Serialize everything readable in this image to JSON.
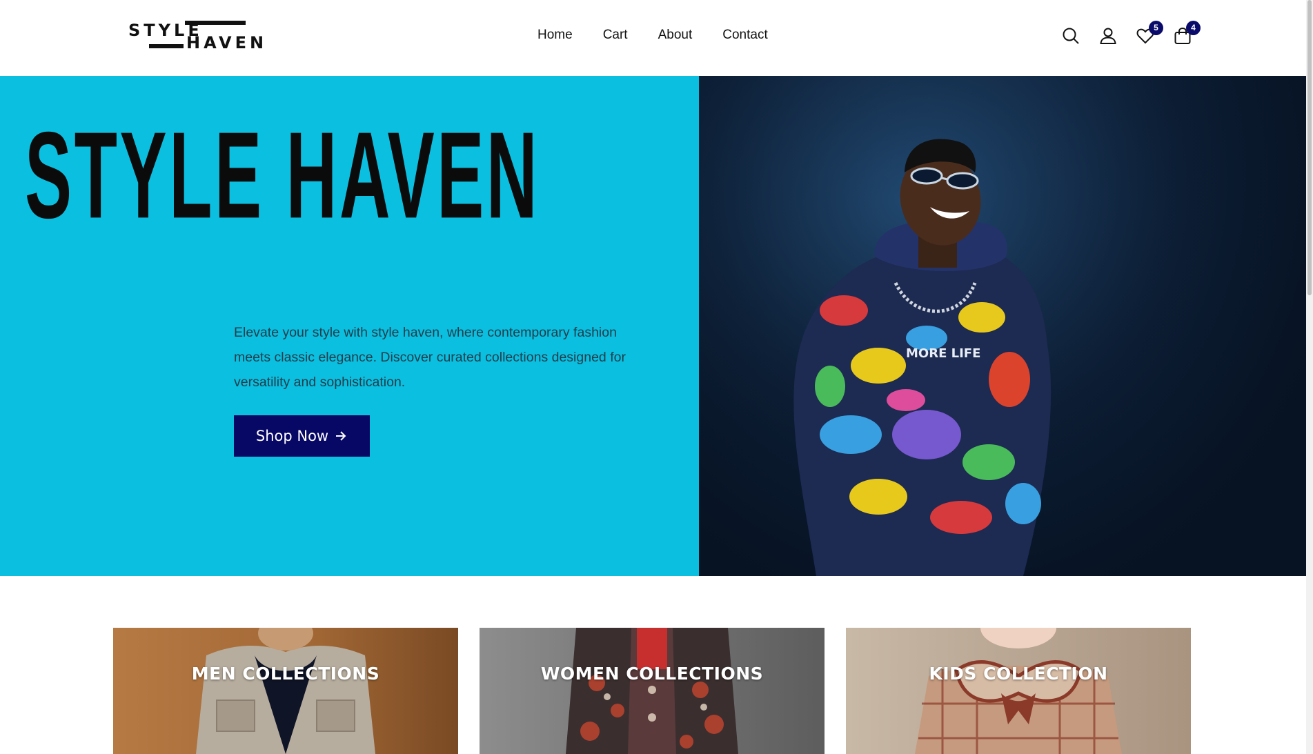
{
  "header": {
    "logo": {
      "word1": "STYLE",
      "word2": "HAVEN"
    },
    "nav": [
      {
        "label": "Home"
      },
      {
        "label": "Cart"
      },
      {
        "label": "About"
      },
      {
        "label": "Contact"
      }
    ],
    "icons": {
      "search": "search-icon",
      "account": "user-icon",
      "wishlist": "heart-icon",
      "wishlist_count": "5",
      "bag": "shopping-bag-icon",
      "bag_count": "4"
    }
  },
  "hero": {
    "title": "STYLE HAVEN",
    "description": "Elevate your style with style haven, where contemporary fashion meets classic elegance. Discover curated collections designed for versatility and sophistication.",
    "cta_label": "Shop Now",
    "cta_icon": "arrow-right-icon",
    "hoodie_text": "MORE LIFE",
    "colors": {
      "left_bg": "#0bbfe0",
      "cta_bg": "#070766"
    }
  },
  "collections": [
    {
      "label": "MEN COLLECTIONS"
    },
    {
      "label": "WOMEN COLLECTIONS"
    },
    {
      "label": "KIDS COLLECTION"
    }
  ]
}
